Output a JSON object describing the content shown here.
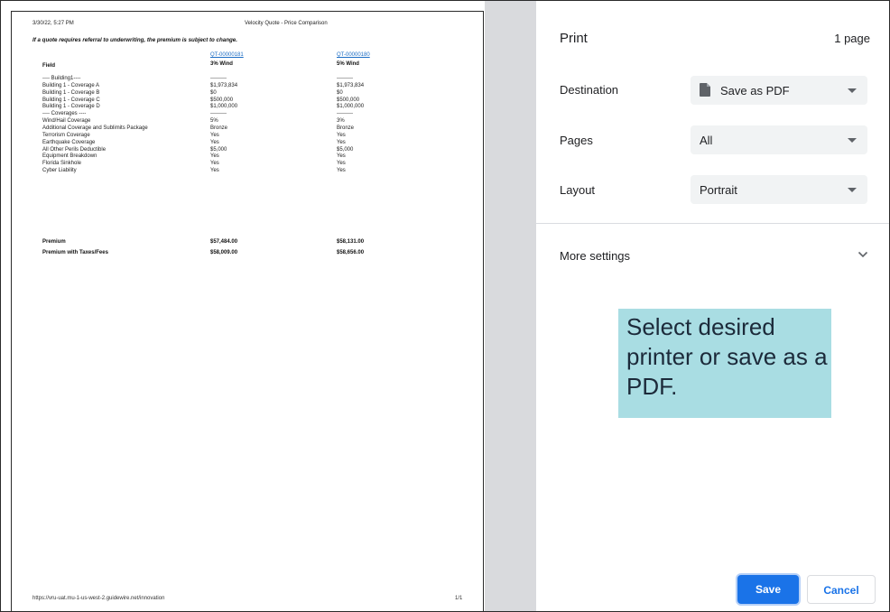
{
  "preview": {
    "header_date": "3/30/22, 5:27 PM",
    "header_title": "Velocity Quote - Price Comparison",
    "notice": "If a quote requires referral to underwriting, the premium is subject to change.",
    "quote_links": [
      "QT-00000181",
      "QT-00000180"
    ],
    "col_field": "Field",
    "col_heads": [
      "3% Wind",
      "5% Wind"
    ],
    "rows": [
      {
        "field": "---- Building1----",
        "a": "---------",
        "b": "---------"
      },
      {
        "field": "Building 1 - Coverage A",
        "a": "$1,973,834",
        "b": "$1,973,834"
      },
      {
        "field": "Building 1 - Coverage B",
        "a": "$0",
        "b": "$0"
      },
      {
        "field": "Building 1 - Coverage C",
        "a": "$500,000",
        "b": "$500,000"
      },
      {
        "field": "Building 1 - Coverage D",
        "a": "$1,000,000",
        "b": "$1,000,000"
      },
      {
        "field": "---- Coverages ----",
        "a": "---------",
        "b": "---------"
      },
      {
        "field": "Wind/Hail Coverage",
        "a": "5%",
        "b": "3%"
      },
      {
        "field": "Additional Coverage and Sublimits Package",
        "a": "Bronze",
        "b": "Bronze"
      },
      {
        "field": "Terrorism Coverage",
        "a": "Yes",
        "b": "Yes"
      },
      {
        "field": "Earthquake Coverage",
        "a": "Yes",
        "b": "Yes"
      },
      {
        "field": "All Other Perils Deductible",
        "a": "$5,000",
        "b": "$5,000"
      },
      {
        "field": "Equipment Breakdown",
        "a": "Yes",
        "b": "Yes"
      },
      {
        "field": "Florida Sinkhole",
        "a": "Yes",
        "b": "Yes"
      },
      {
        "field": "Cyber Liability",
        "a": "Yes",
        "b": "Yes"
      }
    ],
    "totals": [
      {
        "field": "Premium",
        "a": "$57,484.00",
        "b": "$58,131.00"
      },
      {
        "field": "Premium with Taxes/Fees",
        "a": "$58,009.00",
        "b": "$58,656.00"
      }
    ],
    "footer_url": "https://vru-uat.mu-1-us-west-2.guidewire.net/innovation",
    "footer_page": "1/1"
  },
  "panel": {
    "title": "Print",
    "page_count": "1 page",
    "destination_label": "Destination",
    "destination_value": "Save as PDF",
    "destination_icon": "document-icon",
    "pages_label": "Pages",
    "pages_value": "All",
    "layout_label": "Layout",
    "layout_value": "Portrait",
    "more_settings": "More settings",
    "callout": "Select desired printer or save as a PDF.",
    "save": "Save",
    "cancel": "Cancel"
  },
  "colors": {
    "accent": "#1a73e8",
    "callout_bg": "#a9dde3",
    "link": "#1a6cc4"
  }
}
